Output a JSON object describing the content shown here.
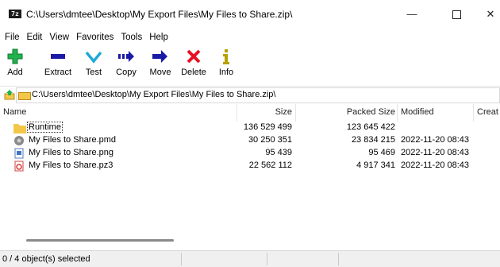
{
  "window": {
    "app_icon_text": "7z",
    "title": "C:\\Users\\dmtee\\Desktop\\My Export Files\\My Files to Share.zip\\",
    "minimize_glyph": "—",
    "close_glyph": "✕"
  },
  "menu": [
    "File",
    "Edit",
    "View",
    "Favorites",
    "Tools",
    "Help"
  ],
  "toolbar": [
    {
      "label": "Add",
      "icon": "add-icon"
    },
    {
      "label": "Extract",
      "icon": "extract-icon"
    },
    {
      "label": "Test",
      "icon": "test-icon"
    },
    {
      "label": "Copy",
      "icon": "copy-icon"
    },
    {
      "label": "Move",
      "icon": "move-icon"
    },
    {
      "label": "Delete",
      "icon": "delete-icon"
    },
    {
      "label": "Info",
      "icon": "info-icon"
    }
  ],
  "address": {
    "path": "C:\\Users\\dmtee\\Desktop\\My Export Files\\My Files to Share.zip\\"
  },
  "columns": {
    "name": "Name",
    "size": "Size",
    "packed": "Packed Size",
    "modified": "Modified",
    "created": "Creat"
  },
  "files": [
    {
      "name": "Runtime",
      "size": "136 529 499",
      "packed": "123 645 422",
      "modified": "",
      "icon": "folder-icon"
    },
    {
      "name": "My Files to Share.pmd",
      "size": "30 250 351",
      "packed": "23 834 215",
      "modified": "2022-11-20 08:43",
      "icon": "pmd-file-icon"
    },
    {
      "name": "My Files to Share.png",
      "size": "95 439",
      "packed": "95 469",
      "modified": "2022-11-20 08:43",
      "icon": "png-file-icon"
    },
    {
      "name": "My Files to Share.pz3",
      "size": "22 562 112",
      "packed": "4 917 341",
      "modified": "2022-11-20 08:43",
      "icon": "pz3-file-icon"
    }
  ],
  "status": {
    "selection": "0 / 4 object(s) selected"
  },
  "colors": {
    "add_green": "#22b14c",
    "extract_blue": "#1a1aa6",
    "test_cyan": "#20a8d8",
    "delete_red": "#e81123",
    "info_gold": "#b8a000",
    "folder_yellow": "#f3c84a"
  }
}
